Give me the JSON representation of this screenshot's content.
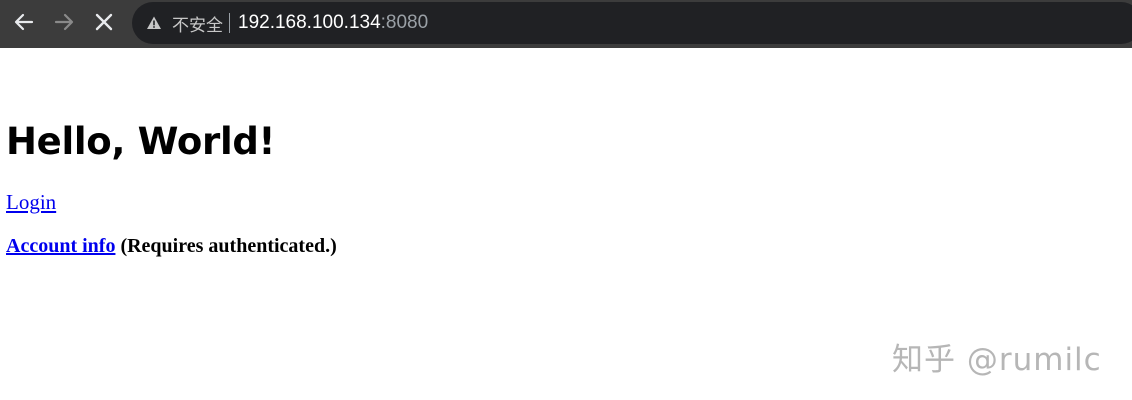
{
  "browser": {
    "security_label": "不安全",
    "url_host": "192.168.100.134",
    "url_port": ":8080",
    "icons": {
      "back": "arrow-left-icon",
      "forward": "arrow-right-icon",
      "stop": "close-icon",
      "warning": "warning-triangle-icon"
    },
    "colors": {
      "toolbar": "#3c3c3c",
      "omnibox": "#202124"
    }
  },
  "page": {
    "title": "Hello, World!",
    "login_link": "Login",
    "account_link": "Account info",
    "account_note": "(Requires authenticated.)"
  },
  "watermark": {
    "text": "知乎 @rumilc"
  }
}
